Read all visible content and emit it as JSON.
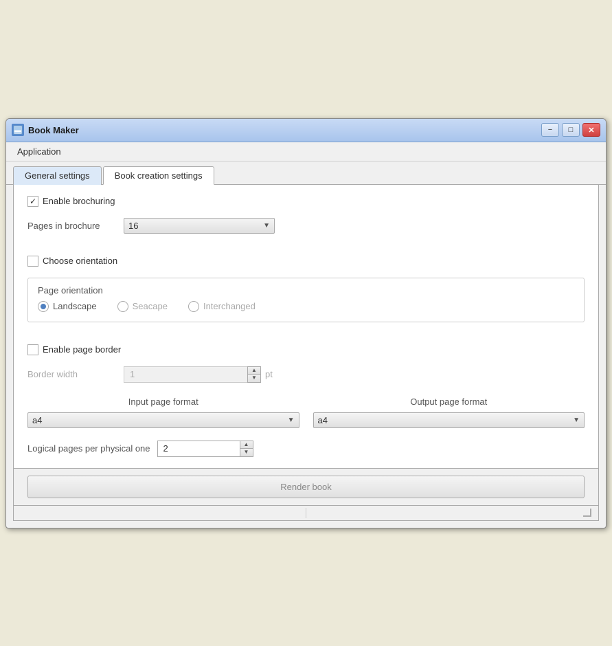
{
  "window": {
    "title": "Book Maker",
    "minimize_label": "−",
    "maximize_label": "□",
    "close_label": "✕"
  },
  "menubar": {
    "items": [
      {
        "label": "Application"
      }
    ]
  },
  "tabs": [
    {
      "label": "General settings",
      "active": false
    },
    {
      "label": "Book creation settings",
      "active": true
    }
  ],
  "content": {
    "enable_brochuring_label": "Enable brochuring",
    "pages_in_brochure_label": "Pages in brochure",
    "pages_in_brochure_value": "16",
    "choose_orientation_label": "Choose orientation",
    "page_orientation_legend": "Page orientation",
    "orientation_options": [
      {
        "label": "Landscape",
        "selected": true
      },
      {
        "label": "Seacape",
        "selected": false
      },
      {
        "label": "Interchanged",
        "selected": false
      }
    ],
    "enable_page_border_label": "Enable page border",
    "border_width_label": "Border width",
    "border_width_value": "1",
    "border_width_unit": "pt",
    "input_page_format_label": "Input page format",
    "input_page_format_value": "a4",
    "output_page_format_label": "Output page format",
    "output_page_format_value": "a4",
    "logical_pages_label": "Logical pages per physical one",
    "logical_pages_value": "2",
    "render_button_label": "Render book"
  }
}
